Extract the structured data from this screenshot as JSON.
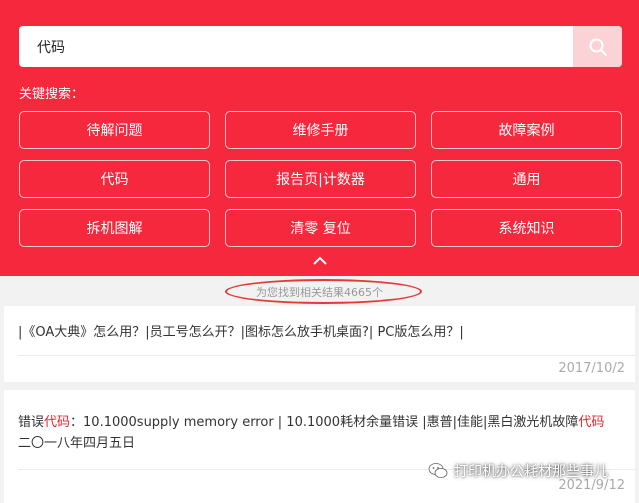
{
  "search": {
    "value": "代码"
  },
  "keywords": {
    "label": "关键搜索：",
    "items": [
      "待解问题",
      "维修手册",
      "故障案例",
      "代码",
      "报告页|计数器",
      "通用",
      "拆机图解",
      "清零 复位",
      "系统知识"
    ]
  },
  "results": {
    "count_text": "为您找到相关结果4665个",
    "items": [
      {
        "text": "|《OA大典》怎么用？|员工号怎么开？|图标怎么放手机桌面?| PC版怎么用？|",
        "date": "2017/10/2"
      },
      {
        "pre": "错误",
        "hl1": "代码",
        "mid": "：10.1000supply memory error | 10.1000耗材余量错误 |惠普|佳能|黑白激光机故障",
        "hl2": "代码",
        "post": " 二〇一八年四月五日",
        "date": "2021/9/12"
      }
    ]
  },
  "watermark": {
    "text": "打印机办公耗材那些事儿"
  },
  "colors": {
    "primary": "#f5283d",
    "highlight": "#e8232d",
    "annotation": "#e53935"
  }
}
